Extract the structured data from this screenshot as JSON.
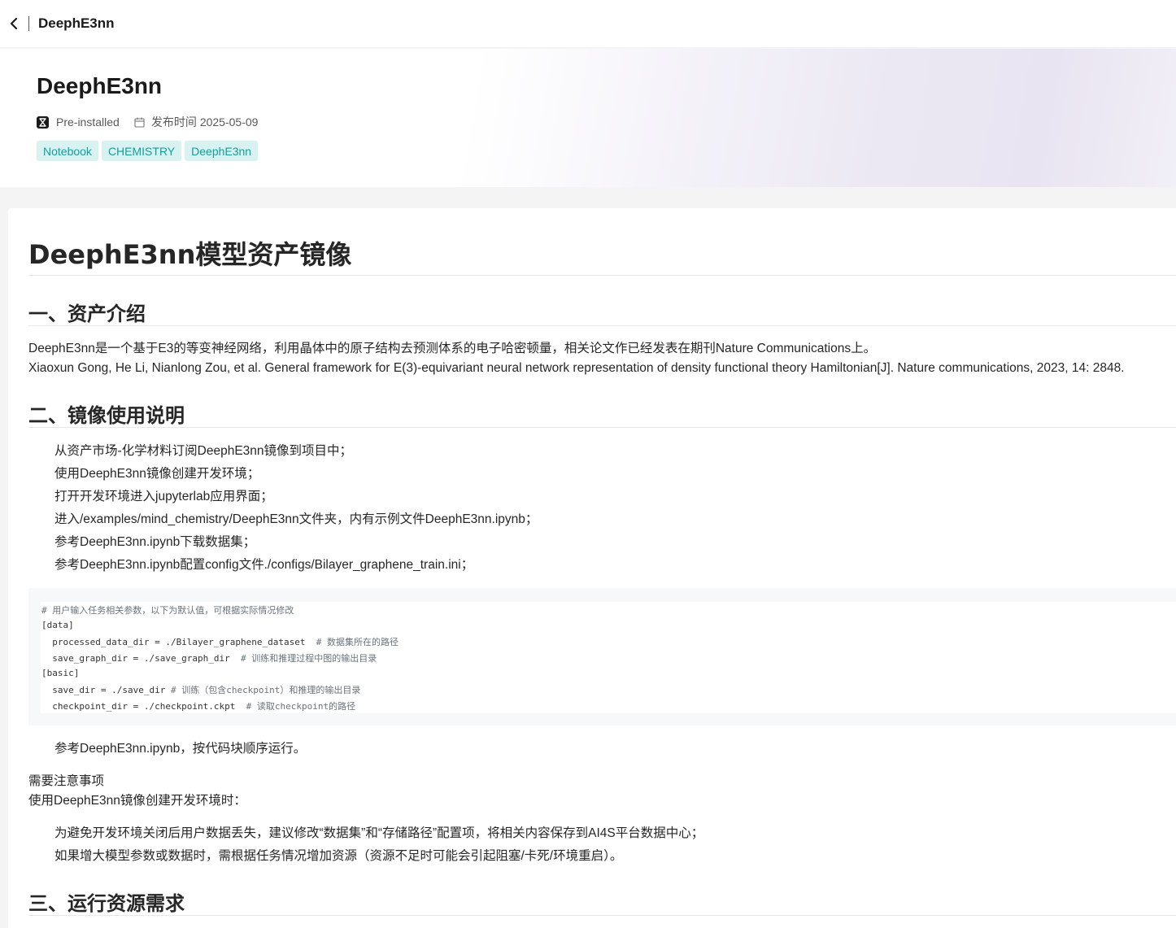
{
  "topbar": {
    "title": "DeephE3nn"
  },
  "hero": {
    "title": "DeephE3nn",
    "badge": "Pre-installed",
    "date_label": "发布时间",
    "date": "2025-05-09",
    "tags": [
      "Notebook",
      "CHEMISTRY",
      "DeephE3nn"
    ]
  },
  "article": {
    "title": "DeephE3nn模型资产镜像",
    "sec1_title": "一、资产介绍",
    "sec1_p1": "DeephE3nn是一个基于E3的等变神经网络，利用晶体中的原子结构去预测体系的电子哈密顿量，相关论文作已经发表在期刊Nature Communications上。",
    "sec1_p2": "Xiaoxun Gong, He Li, Nianlong Zou, et al. General framework for E(3)-equivariant neural network representation of density functional theory Hamiltonian[J]. Nature communications, 2023, 14: 2848.",
    "sec2_title": "二、镜像使用说明",
    "steps": [
      "从资产市场-化学材料订阅DeephE3nn镜像到项目中；",
      "使用DeephE3nn镜像创建开发环境；",
      "打开开发环境进入jupyterlab应用界面；",
      "进入/examples/mind_chemistry/DeephE3nn文件夹，内有示例文件DeephE3nn.ipynb；",
      "参考DeephE3nn.ipynb下载数据集；",
      "参考DeephE3nn.ipynb配置config文件./configs/Bilayer_graphene_train.ini；"
    ],
    "code": {
      "l1": "# 用户输入任务相关参数，以下为默认值，可根据实际情况修改",
      "l2": "[data]",
      "l3": "  processed_data_dir = ./Bilayer_graphene_dataset",
      "l3c": "  # 数据集所在的路径",
      "l4": "  save_graph_dir = ./save_graph_dir",
      "l4c": "  # 训练和推理过程中图的输出目录",
      "l5": "[basic]",
      "l6": "  save_dir = ./save_dir",
      "l6c": " # 训练（包含checkpoint）和推理的输出目录",
      "l7": "  checkpoint_dir = ./checkpoint.ckpt",
      "l7c": "  # 读取checkpoint的路径"
    },
    "step_after": "参考DeephE3nn.ipynb，按代码块顺序运行。",
    "notes_title": "需要注意事项",
    "notes_intro": "使用DeephE3nn镜像创建开发环境时：",
    "notes": [
      "为避免开发环境关闭后用户数据丢失，建议修改“数据集”和“存储路径”配置项，将相关内容保存到AI4S平台数据中心；",
      "如果增大模型参数或数据时，需根据任务情况增加资源（资源不足时可能会引起阻塞/卡死/环境重启）。"
    ],
    "sec3_title": "三、运行资源需求"
  }
}
